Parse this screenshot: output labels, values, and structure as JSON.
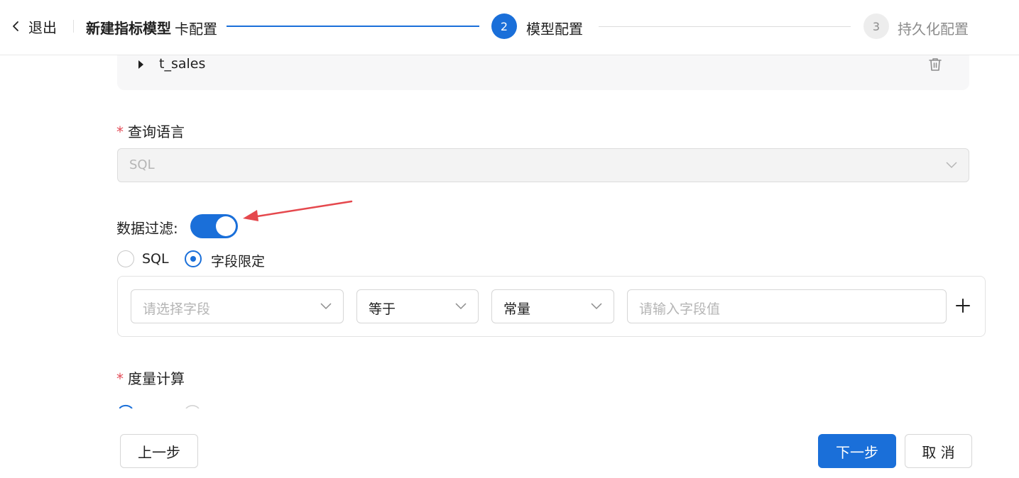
{
  "header": {
    "back_label": "退出",
    "title": "新建指标模型",
    "step1_label": "卡配置",
    "steps": [
      {
        "number": "2",
        "label": "模型配置",
        "state": "active"
      },
      {
        "number": "3",
        "label": "持久化配置",
        "state": "pending"
      }
    ]
  },
  "table_card": {
    "table_name": "t_sales",
    "expand_icon": "caret-right-icon",
    "delete_icon": "trash-icon"
  },
  "query_language": {
    "label": "查询语言",
    "required_mark": "*",
    "value": "SQL"
  },
  "data_filter": {
    "label": "数据过滤:",
    "enabled": true,
    "options": [
      {
        "label": "SQL",
        "checked": false
      },
      {
        "label": "字段限定",
        "checked": true
      }
    ],
    "rule": {
      "field_placeholder": "请选择字段",
      "operator": "等于",
      "value_type": "常量",
      "value_placeholder": "请输入字段值"
    }
  },
  "measure": {
    "label": "度量计算",
    "required_mark": "*"
  },
  "footer": {
    "prev_label": "上一步",
    "next_label": "下一步",
    "cancel_label": "取 消"
  },
  "colors": {
    "primary": "#1a6fd9",
    "required": "#e34d59",
    "annotation_arrow": "#e5484d"
  }
}
